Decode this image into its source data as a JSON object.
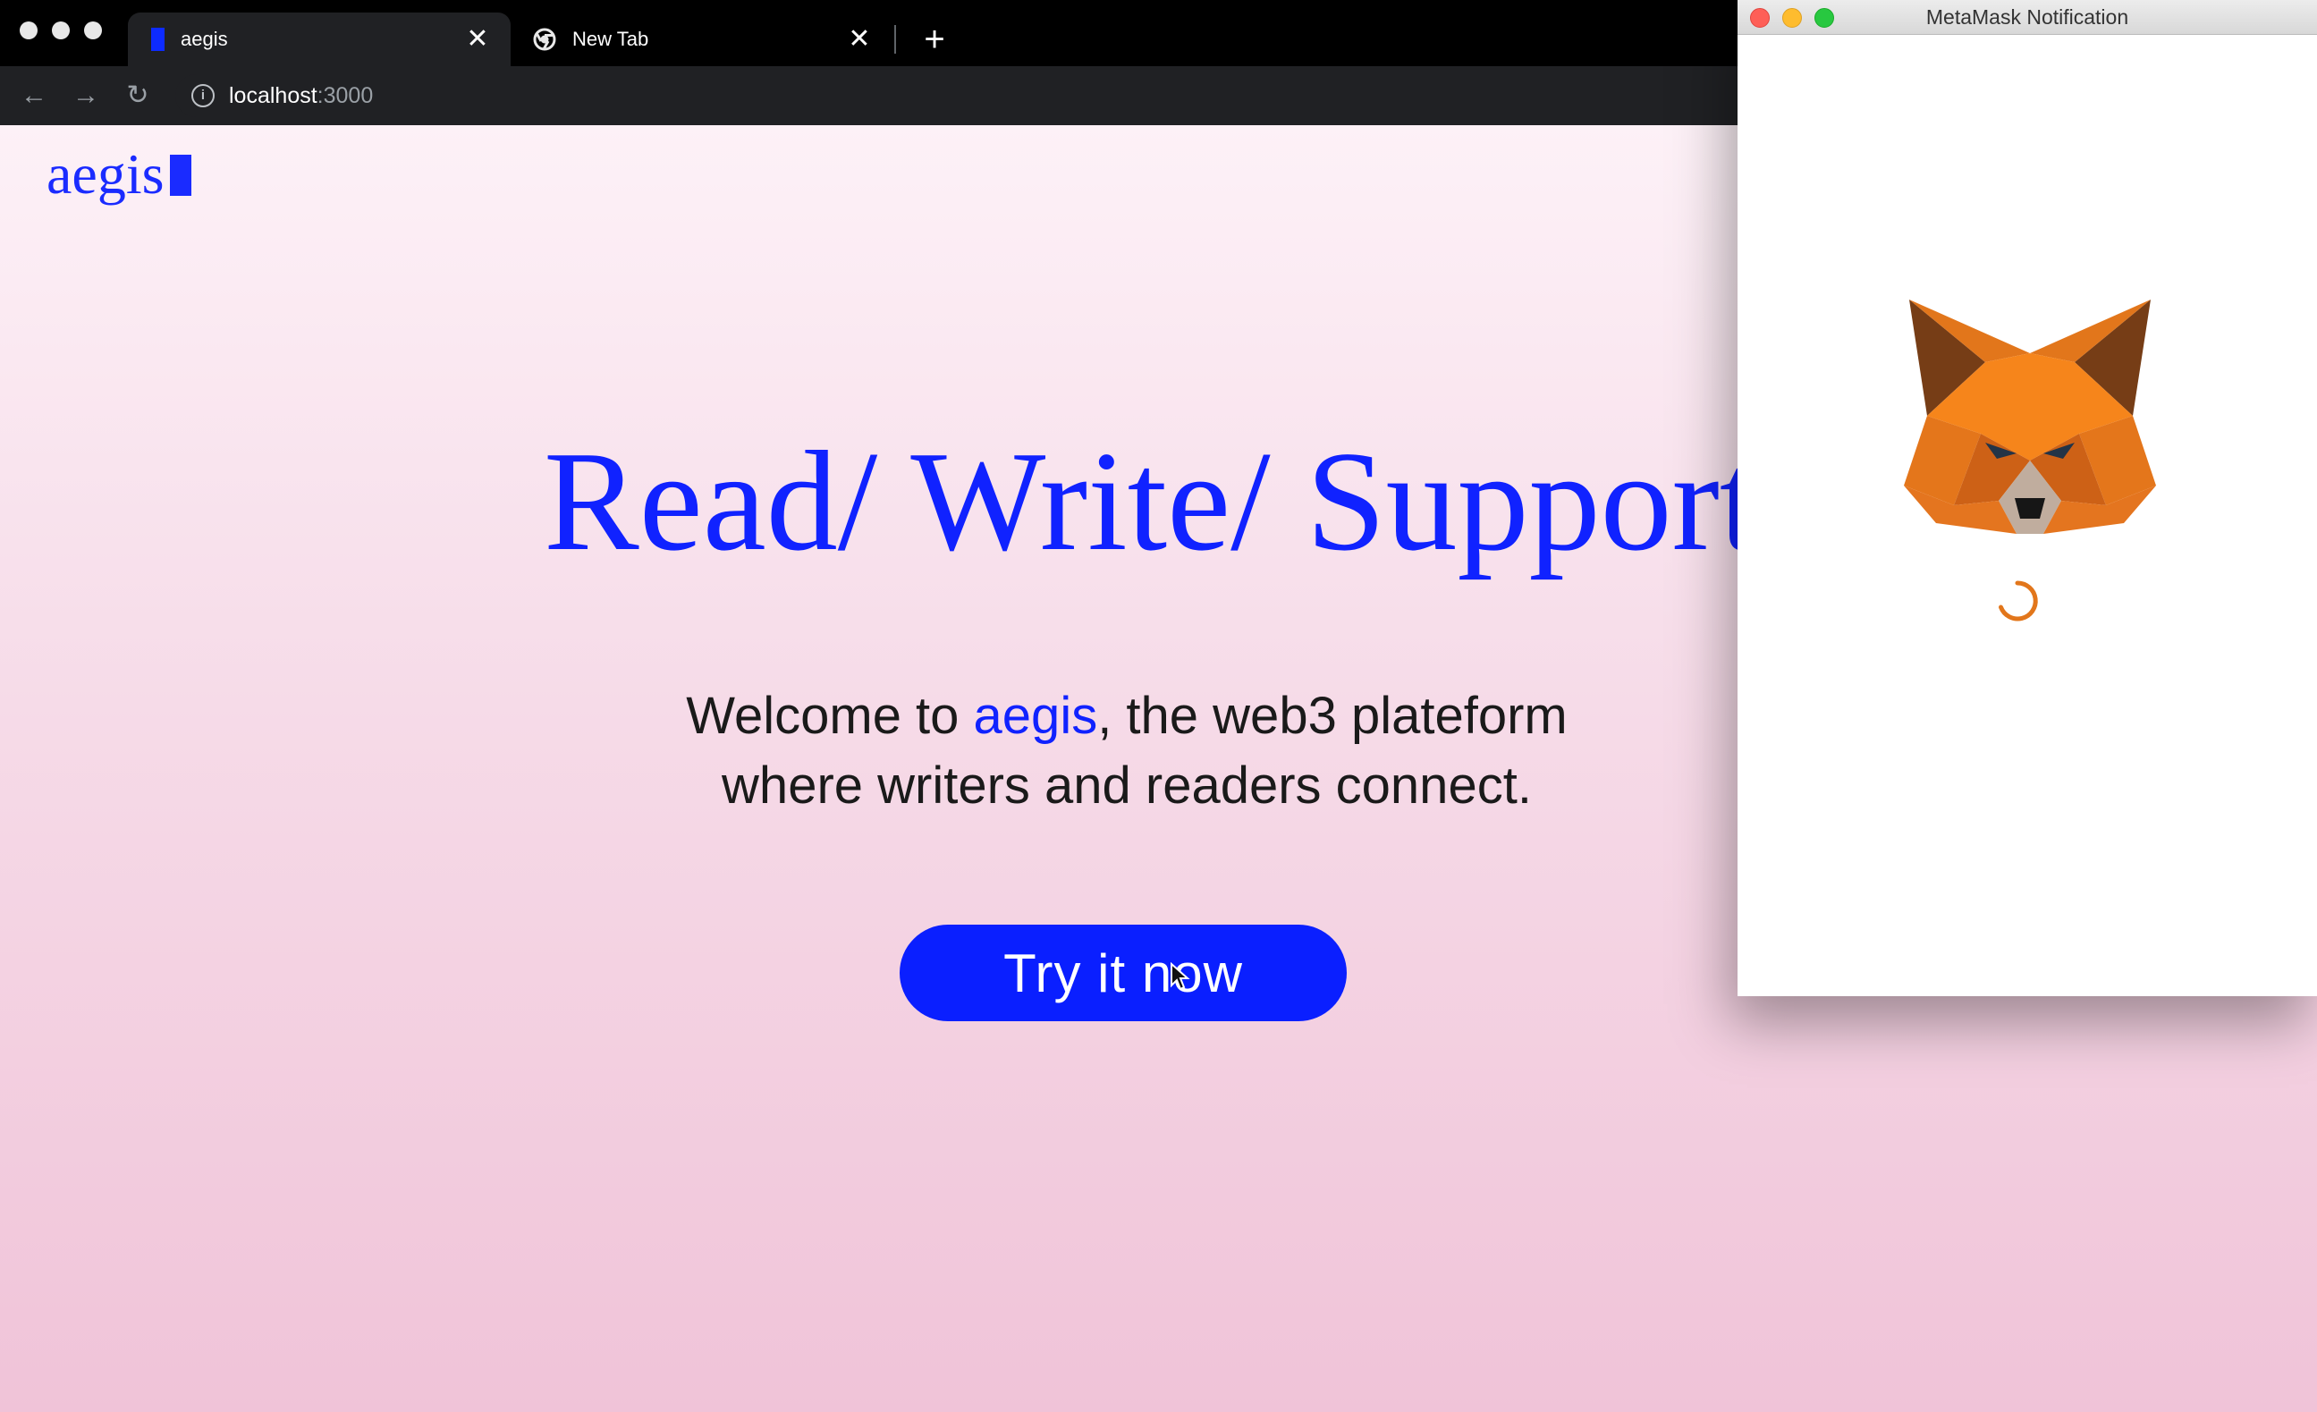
{
  "browser": {
    "tabs": [
      {
        "title": "aegis",
        "active": true,
        "favicon": "aegis-favicon"
      },
      {
        "title": "New Tab",
        "active": false,
        "favicon": "chrome-icon"
      }
    ],
    "close_glyph": "✕",
    "new_tab_glyph": "+",
    "url_host": "localhost",
    "url_port": ":3000"
  },
  "page": {
    "logo_text": "aegis",
    "hero_title": "Read/ Write/ Support",
    "welcome_prefix": "Welcome to ",
    "welcome_brand": "aegis",
    "welcome_suffix": ", the web3 plateform",
    "welcome_line2": "where writers and readers connect.",
    "cta_label": "Try it now"
  },
  "popup": {
    "title": "MetaMask Notification"
  },
  "colors": {
    "brand_blue": "#1022ff",
    "metamask_orange": "#e2761b"
  }
}
